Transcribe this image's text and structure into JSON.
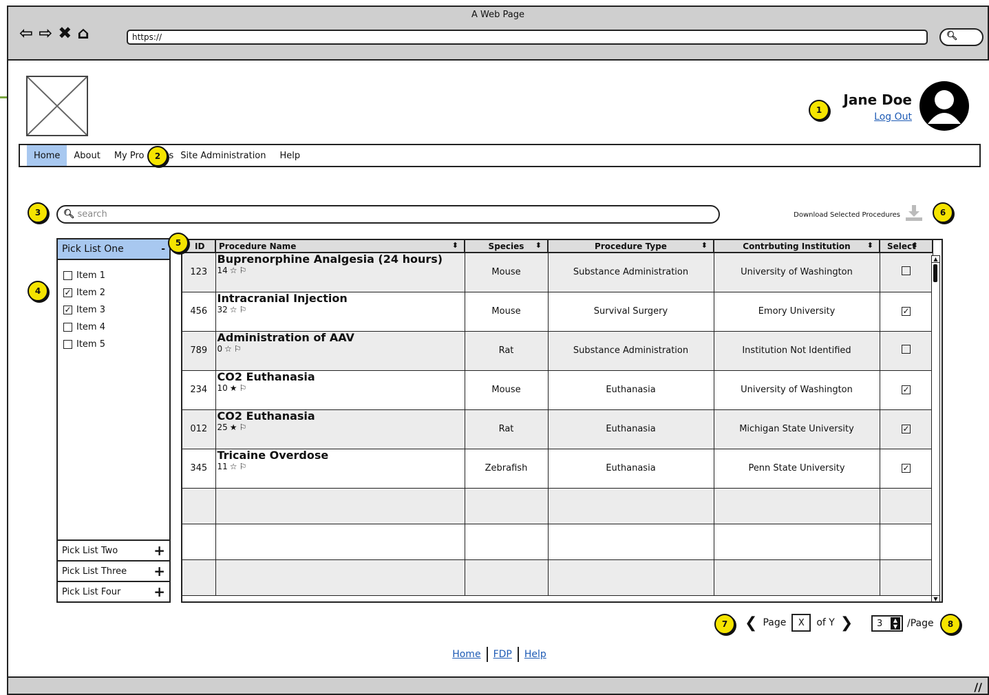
{
  "window": {
    "title": "A Web Page",
    "url": "https://"
  },
  "user": {
    "name": "Jane Doe",
    "logout": "Log Out"
  },
  "nav": {
    "items": [
      "Home",
      "About",
      "My Procedures",
      "Site Administration",
      "Help"
    ]
  },
  "nav_visible": {
    "item2": "My Pro",
    "item2_tail": "s"
  },
  "search": {
    "placeholder": "search"
  },
  "download": {
    "label": "Download Selected Procedures"
  },
  "markers": [
    "1",
    "2",
    "3",
    "4",
    "5",
    "6",
    "7",
    "8"
  ],
  "picklist": {
    "title": "Pick List One",
    "collapse": "-",
    "items": [
      {
        "label": "Item 1",
        "checked": false
      },
      {
        "label": "Item 2",
        "checked": true
      },
      {
        "label": "Item 3",
        "checked": true
      },
      {
        "label": "Item 4",
        "checked": false
      },
      {
        "label": "Item 5",
        "checked": false
      }
    ],
    "others": [
      "Pick List Two",
      "Pick List Three",
      "Pick List Four"
    ]
  },
  "table": {
    "columns": [
      "ID",
      "Procedure Name",
      "Species",
      "Procedure Type",
      "Contrbuting Institution",
      "Select"
    ],
    "id_header_visible": "ID",
    "rows": [
      {
        "id": "123",
        "name": "Buprenorphine Analgesia (24 hours)",
        "rating": "14",
        "starred": false,
        "species": "Mouse",
        "type": "Substance Administration",
        "institution": "University of Washington",
        "selected": false
      },
      {
        "id": "456",
        "name": "Intracranial Injection",
        "rating": "32",
        "starred": false,
        "species": "Mouse",
        "type": "Survival Surgery",
        "institution": "Emory University",
        "selected": true
      },
      {
        "id": "789",
        "name": "Administration of AAV",
        "rating": "0",
        "starred": false,
        "species": "Rat",
        "type": "Substance Administration",
        "institution": "Institution Not Identified",
        "selected": false
      },
      {
        "id": "234",
        "name": "CO2 Euthanasia",
        "rating": "10",
        "starred": true,
        "species": "Mouse",
        "type": "Euthanasia",
        "institution": "University of Washington",
        "selected": true
      },
      {
        "id": "012",
        "name": "CO2 Euthanasia",
        "rating": "25",
        "starred": true,
        "species": "Rat",
        "type": "Euthanasia",
        "institution": "Michigan State University",
        "selected": true
      },
      {
        "id": "345",
        "name": "Tricaine Overdose",
        "rating": "11",
        "starred": false,
        "species": "Zebrafish",
        "type": "Euthanasia",
        "institution": "Penn State University",
        "selected": true
      }
    ],
    "empty_rows": 3
  },
  "pager": {
    "page_label": "Page",
    "page_value": "X",
    "of_label": "of Y",
    "per_page_value": "3",
    "per_page_label": "/Page"
  },
  "footer": {
    "links": [
      "Home",
      "FDP",
      "Help"
    ]
  },
  "colors": {
    "accent": "#a8c8f0",
    "marker": "#f5e400",
    "link": "#1e5bb5",
    "chrome": "#cfcfcf"
  }
}
